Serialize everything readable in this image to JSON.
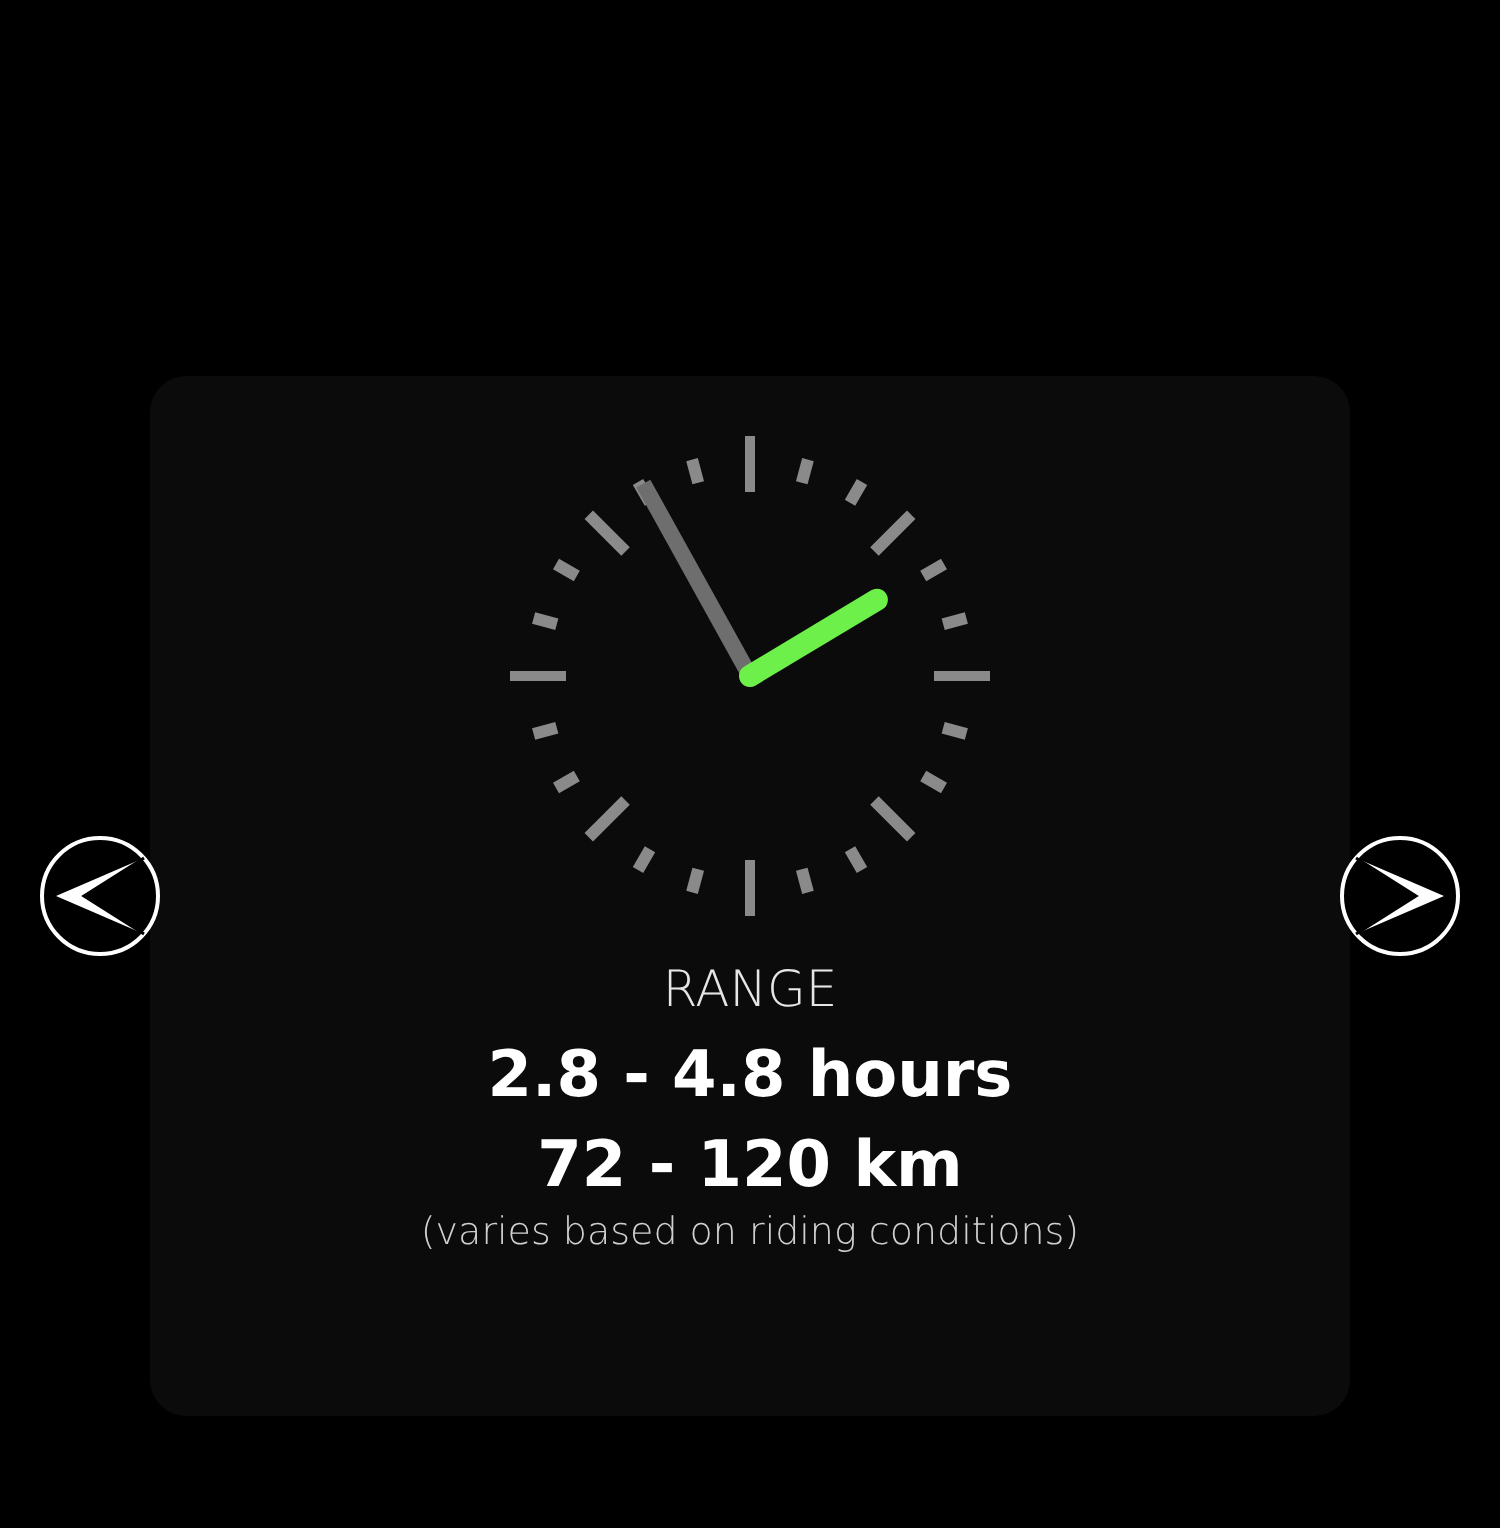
{
  "range": {
    "title": "RANGE",
    "values": [
      "2.8 - 4.8 hours",
      "72 - 120 km"
    ],
    "note": "(varies based on riding conditions)"
  }
}
